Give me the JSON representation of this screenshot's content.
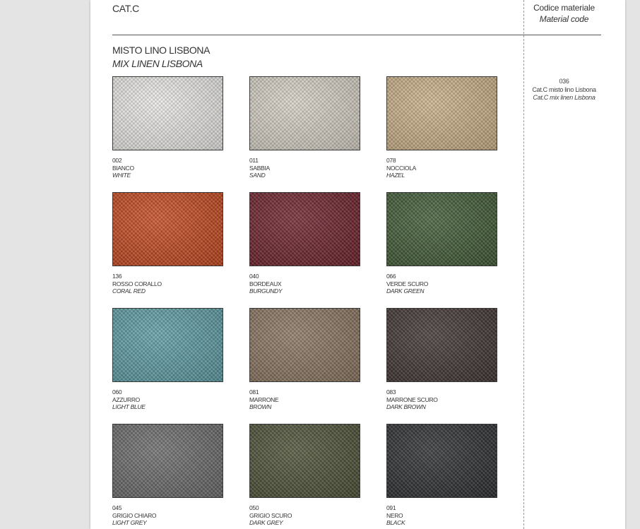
{
  "header": {
    "category": "CAT.C",
    "code_title": "Codice materiale",
    "code_title_en": "Material code"
  },
  "fabric": {
    "name": "MISTO LINO LISBONA",
    "name_en": "MIX LINEN LISBONA"
  },
  "material_code": {
    "code": "036",
    "desc": "Cat.C misto lino Lisbona",
    "desc_en": "Cat.C mix linen Lisbona"
  },
  "swatches": [
    {
      "code": "002",
      "name": "BIANCO",
      "name_en": "WHITE",
      "color": "#eeedea"
    },
    {
      "code": "011",
      "name": "SABBIA",
      "name_en": "SAND",
      "color": "#d9d4c8"
    },
    {
      "code": "078",
      "name": "NOCCIOLA",
      "name_en": "HAZEL",
      "color": "#cdb38a"
    },
    {
      "code": "136",
      "name": "ROSSO CORALLO",
      "name_en": "CORAL RED",
      "color": "#c8471d"
    },
    {
      "code": "040",
      "name": "BORDEAUX",
      "name_en": "BURGUNDY",
      "color": "#6e1f2a"
    },
    {
      "code": "066",
      "name": "VERDE SCURO",
      "name_en": "DARK GREEN",
      "color": "#3f5a34"
    },
    {
      "code": "060",
      "name": "AZZURRO",
      "name_en": "LIGHT BLUE",
      "color": "#5d9ea6"
    },
    {
      "code": "081",
      "name": "MARRONE",
      "name_en": "BROWN",
      "color": "#8a7560"
    },
    {
      "code": "083",
      "name": "MARRONE SCURO",
      "name_en": "DARK BROWN",
      "color": "#3e3330"
    },
    {
      "code": "045",
      "name": "GRIGIO CHIARO",
      "name_en": "LIGHT GREY",
      "color": "#6b6b6b"
    },
    {
      "code": "050",
      "name": "GRIGIO SCURO",
      "name_en": "DARK GREY",
      "color": "#4b5034"
    },
    {
      "code": "091",
      "name": "NERO",
      "name_en": "BLACK",
      "color": "#2b2c2e"
    }
  ]
}
